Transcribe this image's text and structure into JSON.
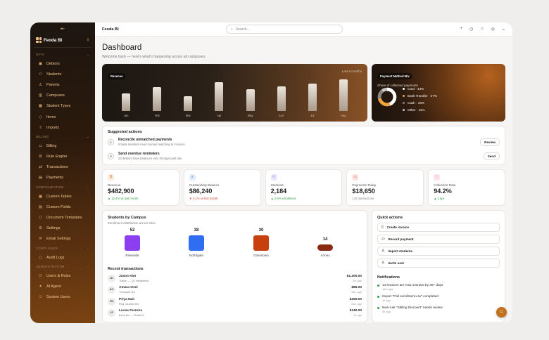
{
  "app": {
    "name": "Feoda BI",
    "topbar_title": "Feoda BI"
  },
  "search": {
    "placeholder": "Search..."
  },
  "sidebar": {
    "sections": [
      {
        "label": "DATA",
        "items": [
          {
            "label": "Debtors",
            "icon": "briefcase"
          },
          {
            "label": "Students",
            "icon": "users"
          },
          {
            "label": "Parents",
            "icon": "user"
          },
          {
            "label": "Campuses",
            "icon": "building"
          },
          {
            "label": "Student Types",
            "icon": "grid"
          },
          {
            "label": "Items",
            "icon": "tag"
          },
          {
            "label": "Imports",
            "icon": "upload"
          }
        ]
      },
      {
        "label": "BILLING",
        "items": [
          {
            "label": "Billing",
            "icon": "card"
          },
          {
            "label": "Rule Engine",
            "icon": "gear"
          },
          {
            "label": "Transactions",
            "icon": "arrows"
          },
          {
            "label": "Payments",
            "icon": "wallet"
          }
        ]
      },
      {
        "label": "CONFIGURATION",
        "items": [
          {
            "label": "Custom Tables",
            "icon": "table"
          },
          {
            "label": "Custom Fields",
            "icon": "fields"
          },
          {
            "label": "Document Templates",
            "icon": "document"
          },
          {
            "label": "Settings",
            "icon": "gear"
          },
          {
            "label": "Email Settings",
            "icon": "mail"
          }
        ]
      },
      {
        "label": "COMPLIANCE",
        "items": [
          {
            "label": "Audit Logs",
            "icon": "clipboard"
          }
        ]
      },
      {
        "label": "ADMINISTRATION",
        "items": [
          {
            "label": "Users & Roles",
            "icon": "users"
          },
          {
            "label": "AI Agent",
            "icon": "sparkle"
          },
          {
            "label": "System Users",
            "icon": "user-gear"
          }
        ]
      }
    ]
  },
  "page": {
    "title": "Dashboard",
    "subtitle": "Welcome back — here's what's happening across all campuses."
  },
  "revenue": {
    "label": "Revenue",
    "period": "Last 8 months"
  },
  "payment_mix": {
    "label": "Payment Method Mix",
    "caption": "Share of collected payments",
    "items": [
      {
        "label": "Card · 44%",
        "color": "#ffffff"
      },
      {
        "label": "Bank Transfer · 27%",
        "color": "#f0a43c"
      },
      {
        "label": "Cash · 18%",
        "color": "#8a8580"
      },
      {
        "label": "Other · 11%",
        "color": "#c9c3bd"
      }
    ]
  },
  "suggested": {
    "title": "Suggested actions",
    "items": [
      {
        "title": "Reconcile unmatched payments",
        "desc": "5 bank transfers need manual matching to invoices.",
        "button": "Review",
        "icon": "reconcile"
      },
      {
        "title": "Send overdue reminders",
        "desc": "23 debtors have balances over 30 days past due.",
        "button": "Send",
        "icon": "mail"
      }
    ]
  },
  "kpis": [
    {
      "label": "Revenue",
      "value": "$482,900",
      "delta": "▲ 12.4% vs last month",
      "trend": "up",
      "icon": "$",
      "icon_bg": "#fde8dc",
      "icon_color": "#d9631b"
    },
    {
      "label": "Outstanding Balance",
      "value": "$86,240",
      "delta": "▼ 3.1% vs last month",
      "trend": "down",
      "icon": "≡",
      "icon_bg": "#e3ecfb",
      "icon_color": "#3b6fd8"
    },
    {
      "label": "Students",
      "value": "2,184",
      "delta": "▲ 2.8% enrollment",
      "trend": "up",
      "icon": "⚇",
      "icon_bg": "#ece6fb",
      "icon_color": "#7a4fd8"
    },
    {
      "label": "Payments Today",
      "value": "$18,650",
      "delta": "142 transactions",
      "trend": "neutral",
      "icon": "▭",
      "icon_bg": "#fde4e0",
      "icon_color": "#d9463b"
    },
    {
      "label": "Collection Rate",
      "value": "94.2%",
      "delta": "▲ 1.6pt",
      "trend": "up",
      "icon": "♡",
      "icon_bg": "#fde4ea",
      "icon_color": "#d93b5c"
    }
  ],
  "students_by_campus": {
    "title": "Students by Campus",
    "subtitle": "Enrollment distribution across sites",
    "campuses": [
      {
        "label": "Riverside",
        "count": "52",
        "color": "#8b3ff0"
      },
      {
        "label": "Northgate",
        "count": "38",
        "color": "#2f6ef0"
      },
      {
        "label": "Downtown",
        "count": "30",
        "color": "#c7410f"
      },
      {
        "label": "Annex",
        "count": "14",
        "color": "#8a2a12"
      }
    ]
  },
  "chart_data": {
    "type": "bar",
    "title": "Revenue",
    "categories": [
      "Jan",
      "Feb",
      "Mar",
      "Apr",
      "May",
      "Jun",
      "Jul",
      "Aug"
    ],
    "values": [
      28,
      38,
      24,
      46,
      35,
      40,
      44,
      51
    ],
    "ylim": [
      0,
      60
    ],
    "xlabel": "",
    "ylabel": "",
    "grid": false
  },
  "transactions": {
    "title": "Recent transactions",
    "items": [
      {
        "initials": "JK",
        "name": "Jason Kim",
        "desc": "Tuition — Q3 installment",
        "amount": "$1,200.00",
        "time": "2m ago"
      },
      {
        "initials": "AO",
        "name": "Amara Osei",
        "desc": "Transport fee",
        "amount": "$85.00",
        "time": "18m ago"
      },
      {
        "initials": "PN",
        "name": "Priya Nair",
        "desc": "Reg. student fee",
        "amount": "$250.00",
        "time": "41m ago"
      },
      {
        "initials": "LF",
        "name": "Lucas Ferreira",
        "desc": "Book fee — Grade 6",
        "amount": "$140.00",
        "time": "1h ago"
      }
    ]
  },
  "quick_actions": {
    "title": "Quick actions",
    "items": [
      {
        "label": "Create invoice",
        "icon": "document"
      },
      {
        "label": "Record payment",
        "icon": "card"
      },
      {
        "label": "Import students",
        "icon": "user"
      },
      {
        "label": "Invite user",
        "icon": "user-plus"
      }
    ]
  },
  "notifications": {
    "title": "Notifications",
    "items": [
      {
        "text": "14 invoices are now overdue by 30+ days",
        "time": "18m ago"
      },
      {
        "text": "Import \"Fall enrollment.csv\" completed",
        "time": "1h ago"
      },
      {
        "text": "New rule \"Sibling Discount\" needs review",
        "time": "3h ago"
      }
    ]
  },
  "colors": {
    "accent": "#c2711f",
    "up": "#2f9e44",
    "down": "#d63b2f"
  }
}
